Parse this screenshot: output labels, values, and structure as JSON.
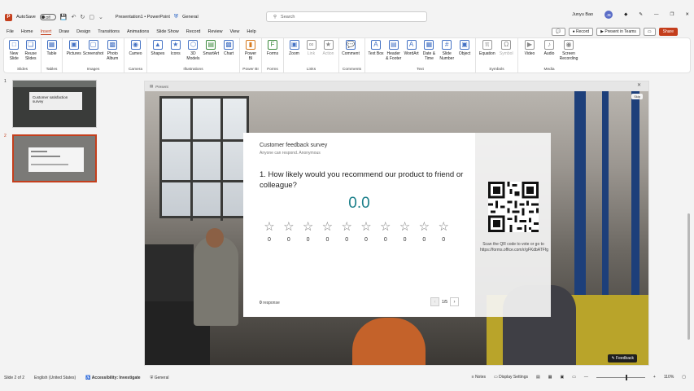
{
  "titlebar": {
    "autosave_label": "AutoSave",
    "autosave_state": "Off",
    "doc_title": "Presentation1 • PowerPoint",
    "sensitivity": "General",
    "search_placeholder": "Search",
    "user_name": "Junyu Bao",
    "user_initials": "JB"
  },
  "menu": {
    "tabs": [
      "File",
      "Home",
      "Insert",
      "Draw",
      "Design",
      "Transitions",
      "Animations",
      "Slide Show",
      "Record",
      "Review",
      "View",
      "Help"
    ],
    "active_tab": "Insert",
    "record_label": "Record",
    "present_teams_label": "Present in Teams",
    "share_label": "Share"
  },
  "ribbon": {
    "groups": {
      "slides": "Slides",
      "tables": "Tables",
      "images": "Images",
      "camera": "Camera",
      "illustrations": "Illustrations",
      "powerbi": "Power BI",
      "forms": "Forms",
      "links": "Links",
      "comments": "Comments",
      "text": "Text",
      "symbols": "Symbols",
      "media": "Media"
    },
    "buttons": {
      "new_slide": "New Slide",
      "reuse_slides": "Reuse Slides",
      "table": "Table",
      "pictures": "Pictures",
      "screenshot": "Screenshot",
      "photo_album": "Photo Album",
      "cameo": "Cameo",
      "shapes": "Shapes",
      "icons": "Icons",
      "models_3d": "3D Models",
      "smartart": "SmartArt",
      "chart": "Chart",
      "power_bi": "Power BI",
      "forms": "Forms",
      "zoom": "Zoom",
      "link": "Link",
      "action": "Action",
      "comment": "Comment",
      "text_box": "Text Box",
      "header_footer": "Header & Footer",
      "wordart": "WordArt",
      "date_time": "Date & Time",
      "slide_number": "Slide Number",
      "object": "Object",
      "equation": "Equation",
      "symbol": "Symbol",
      "video": "Video",
      "audio": "Audio",
      "screen_recording": "Screen Recording"
    }
  },
  "thumbnails": {
    "slide1_num": "1",
    "slide1_title": "Customer satisfaction survey",
    "slide2_num": "2"
  },
  "slide": {
    "topbar_label": "Present",
    "skip_label": "Skip",
    "survey_title": "Customer feedback survey",
    "survey_subtitle": "Anyone can respond. Anonymous",
    "question": "1. How likely would you recommend our product to friend or colleague?",
    "score": "0.0",
    "star_counts": [
      "0",
      "0",
      "0",
      "0",
      "0",
      "0",
      "0",
      "0",
      "0",
      "0"
    ],
    "response_count": "0",
    "response_label": "response",
    "pager": "1/5",
    "scan_text": "Scan the QR code to vote or go to https://forms.office.com/r/gFKdbATFfg",
    "feedback_label": "Feedback"
  },
  "statusbar": {
    "slide_info": "Slide 2 of 2",
    "language": "English (United States)",
    "accessibility": "Accessibility: Investigate",
    "sensitivity": "General",
    "notes": "Notes",
    "display_settings": "Display Settings",
    "zoom": "110%"
  },
  "colors": {
    "accent": "#c43e1c",
    "score_teal": "#1b7f8a"
  }
}
